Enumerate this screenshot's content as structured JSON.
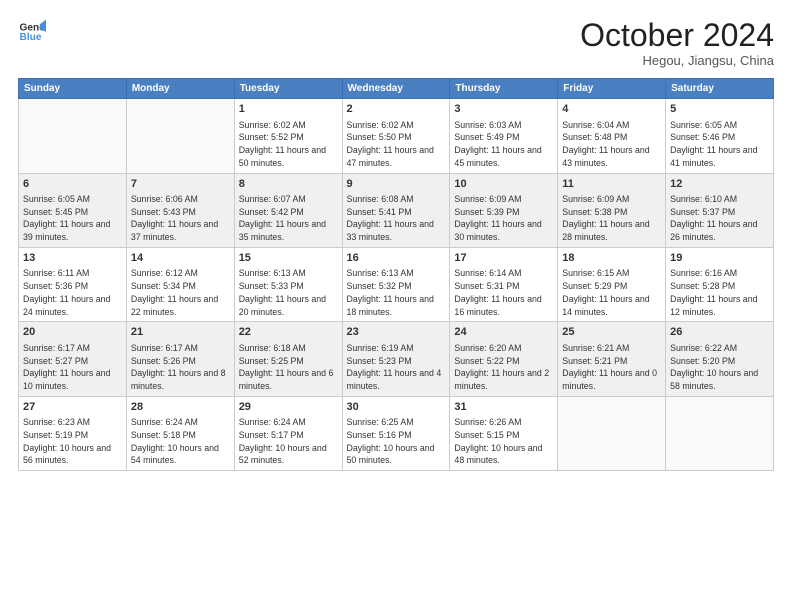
{
  "header": {
    "logo_line1": "General",
    "logo_line2": "Blue",
    "main_title": "October 2024",
    "sub_title": "Hegou, Jiangsu, China"
  },
  "days_of_week": [
    "Sunday",
    "Monday",
    "Tuesday",
    "Wednesday",
    "Thursday",
    "Friday",
    "Saturday"
  ],
  "weeks": [
    [
      {
        "day": "",
        "info": ""
      },
      {
        "day": "",
        "info": ""
      },
      {
        "day": "1",
        "info": "Sunrise: 6:02 AM\nSunset: 5:52 PM\nDaylight: 11 hours and 50 minutes."
      },
      {
        "day": "2",
        "info": "Sunrise: 6:02 AM\nSunset: 5:50 PM\nDaylight: 11 hours and 47 minutes."
      },
      {
        "day": "3",
        "info": "Sunrise: 6:03 AM\nSunset: 5:49 PM\nDaylight: 11 hours and 45 minutes."
      },
      {
        "day": "4",
        "info": "Sunrise: 6:04 AM\nSunset: 5:48 PM\nDaylight: 11 hours and 43 minutes."
      },
      {
        "day": "5",
        "info": "Sunrise: 6:05 AM\nSunset: 5:46 PM\nDaylight: 11 hours and 41 minutes."
      }
    ],
    [
      {
        "day": "6",
        "info": "Sunrise: 6:05 AM\nSunset: 5:45 PM\nDaylight: 11 hours and 39 minutes."
      },
      {
        "day": "7",
        "info": "Sunrise: 6:06 AM\nSunset: 5:43 PM\nDaylight: 11 hours and 37 minutes."
      },
      {
        "day": "8",
        "info": "Sunrise: 6:07 AM\nSunset: 5:42 PM\nDaylight: 11 hours and 35 minutes."
      },
      {
        "day": "9",
        "info": "Sunrise: 6:08 AM\nSunset: 5:41 PM\nDaylight: 11 hours and 33 minutes."
      },
      {
        "day": "10",
        "info": "Sunrise: 6:09 AM\nSunset: 5:39 PM\nDaylight: 11 hours and 30 minutes."
      },
      {
        "day": "11",
        "info": "Sunrise: 6:09 AM\nSunset: 5:38 PM\nDaylight: 11 hours and 28 minutes."
      },
      {
        "day": "12",
        "info": "Sunrise: 6:10 AM\nSunset: 5:37 PM\nDaylight: 11 hours and 26 minutes."
      }
    ],
    [
      {
        "day": "13",
        "info": "Sunrise: 6:11 AM\nSunset: 5:36 PM\nDaylight: 11 hours and 24 minutes."
      },
      {
        "day": "14",
        "info": "Sunrise: 6:12 AM\nSunset: 5:34 PM\nDaylight: 11 hours and 22 minutes."
      },
      {
        "day": "15",
        "info": "Sunrise: 6:13 AM\nSunset: 5:33 PM\nDaylight: 11 hours and 20 minutes."
      },
      {
        "day": "16",
        "info": "Sunrise: 6:13 AM\nSunset: 5:32 PM\nDaylight: 11 hours and 18 minutes."
      },
      {
        "day": "17",
        "info": "Sunrise: 6:14 AM\nSunset: 5:31 PM\nDaylight: 11 hours and 16 minutes."
      },
      {
        "day": "18",
        "info": "Sunrise: 6:15 AM\nSunset: 5:29 PM\nDaylight: 11 hours and 14 minutes."
      },
      {
        "day": "19",
        "info": "Sunrise: 6:16 AM\nSunset: 5:28 PM\nDaylight: 11 hours and 12 minutes."
      }
    ],
    [
      {
        "day": "20",
        "info": "Sunrise: 6:17 AM\nSunset: 5:27 PM\nDaylight: 11 hours and 10 minutes."
      },
      {
        "day": "21",
        "info": "Sunrise: 6:17 AM\nSunset: 5:26 PM\nDaylight: 11 hours and 8 minutes."
      },
      {
        "day": "22",
        "info": "Sunrise: 6:18 AM\nSunset: 5:25 PM\nDaylight: 11 hours and 6 minutes."
      },
      {
        "day": "23",
        "info": "Sunrise: 6:19 AM\nSunset: 5:23 PM\nDaylight: 11 hours and 4 minutes."
      },
      {
        "day": "24",
        "info": "Sunrise: 6:20 AM\nSunset: 5:22 PM\nDaylight: 11 hours and 2 minutes."
      },
      {
        "day": "25",
        "info": "Sunrise: 6:21 AM\nSunset: 5:21 PM\nDaylight: 11 hours and 0 minutes."
      },
      {
        "day": "26",
        "info": "Sunrise: 6:22 AM\nSunset: 5:20 PM\nDaylight: 10 hours and 58 minutes."
      }
    ],
    [
      {
        "day": "27",
        "info": "Sunrise: 6:23 AM\nSunset: 5:19 PM\nDaylight: 10 hours and 56 minutes."
      },
      {
        "day": "28",
        "info": "Sunrise: 6:24 AM\nSunset: 5:18 PM\nDaylight: 10 hours and 54 minutes."
      },
      {
        "day": "29",
        "info": "Sunrise: 6:24 AM\nSunset: 5:17 PM\nDaylight: 10 hours and 52 minutes."
      },
      {
        "day": "30",
        "info": "Sunrise: 6:25 AM\nSunset: 5:16 PM\nDaylight: 10 hours and 50 minutes."
      },
      {
        "day": "31",
        "info": "Sunrise: 6:26 AM\nSunset: 5:15 PM\nDaylight: 10 hours and 48 minutes."
      },
      {
        "day": "",
        "info": ""
      },
      {
        "day": "",
        "info": ""
      }
    ]
  ]
}
